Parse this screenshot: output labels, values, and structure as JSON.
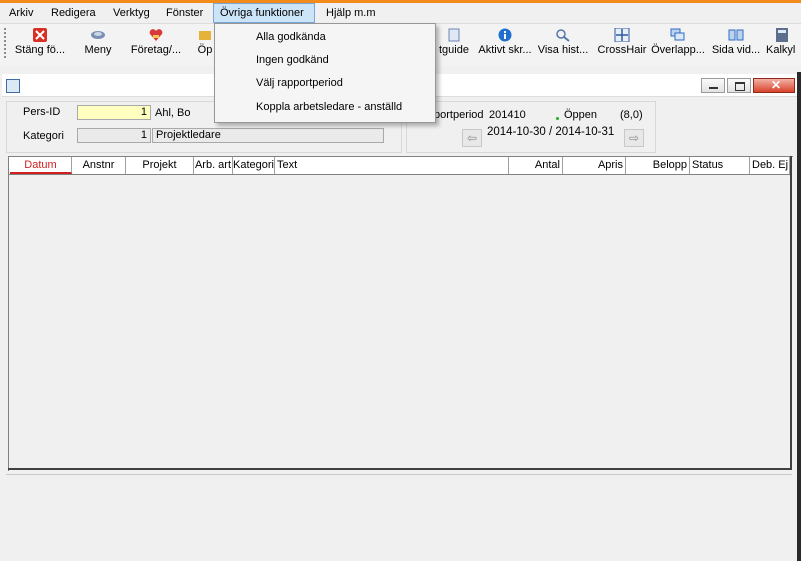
{
  "menubar": {
    "items": [
      "Arkiv",
      "Redigera",
      "Verktyg",
      "Fönster",
      "Övriga funktioner",
      "Hjälp m.m"
    ],
    "active": "Övriga funktioner"
  },
  "toolbar": {
    "buttons": [
      {
        "label": "Stäng fö...",
        "icon": "close-icon"
      },
      {
        "label": "Meny",
        "icon": "menu-icon"
      },
      {
        "label": "Företag/...",
        "icon": "company-icon"
      },
      {
        "label": "Öp",
        "icon": "open-icon"
      },
      {
        "label": "tguide",
        "icon": "guide-icon"
      },
      {
        "label": "Aktivt skr...",
        "icon": "info-icon"
      },
      {
        "label": "Visa hist...",
        "icon": "history-icon"
      },
      {
        "label": "CrossHair",
        "icon": "crosshair-icon"
      },
      {
        "label": "Överlapp...",
        "icon": "overlap-icon"
      },
      {
        "label": "Sida vid...",
        "icon": "side-by-side-icon"
      },
      {
        "label": "Kalkyl",
        "icon": "calculator-icon"
      }
    ]
  },
  "dropdown": {
    "items": [
      "Alla godkända",
      "Ingen godkänd",
      "Välj rapportperiod",
      "Koppla arbetsledare - anställd"
    ]
  },
  "form": {
    "pers_id_label": "Pers-ID",
    "pers_id_value": "1",
    "pers_name": "Ahl, Bo",
    "kategori_label": "Kategori",
    "kategori_value": "1",
    "kategori_name": "Projektledare"
  },
  "period": {
    "label": "portperiod",
    "value": "201410",
    "status": "Öppen",
    "count": "(8,0)",
    "range": "2014-10-30 / 2014-10-31"
  },
  "grid": {
    "columns": [
      "Datum",
      "Anstnr",
      "Projekt",
      "Arb. art",
      "Kategori",
      "Text",
      "Antal",
      "Apris",
      "Belopp",
      "Status",
      "Deb. Ej"
    ],
    "sorted_column": "Datum"
  },
  "colors": {
    "accent_strip": "#f28a1c",
    "pers_id_highlight": "#ffffc0",
    "status_dot": "#22aa22",
    "sorted_header": "#d02020"
  }
}
